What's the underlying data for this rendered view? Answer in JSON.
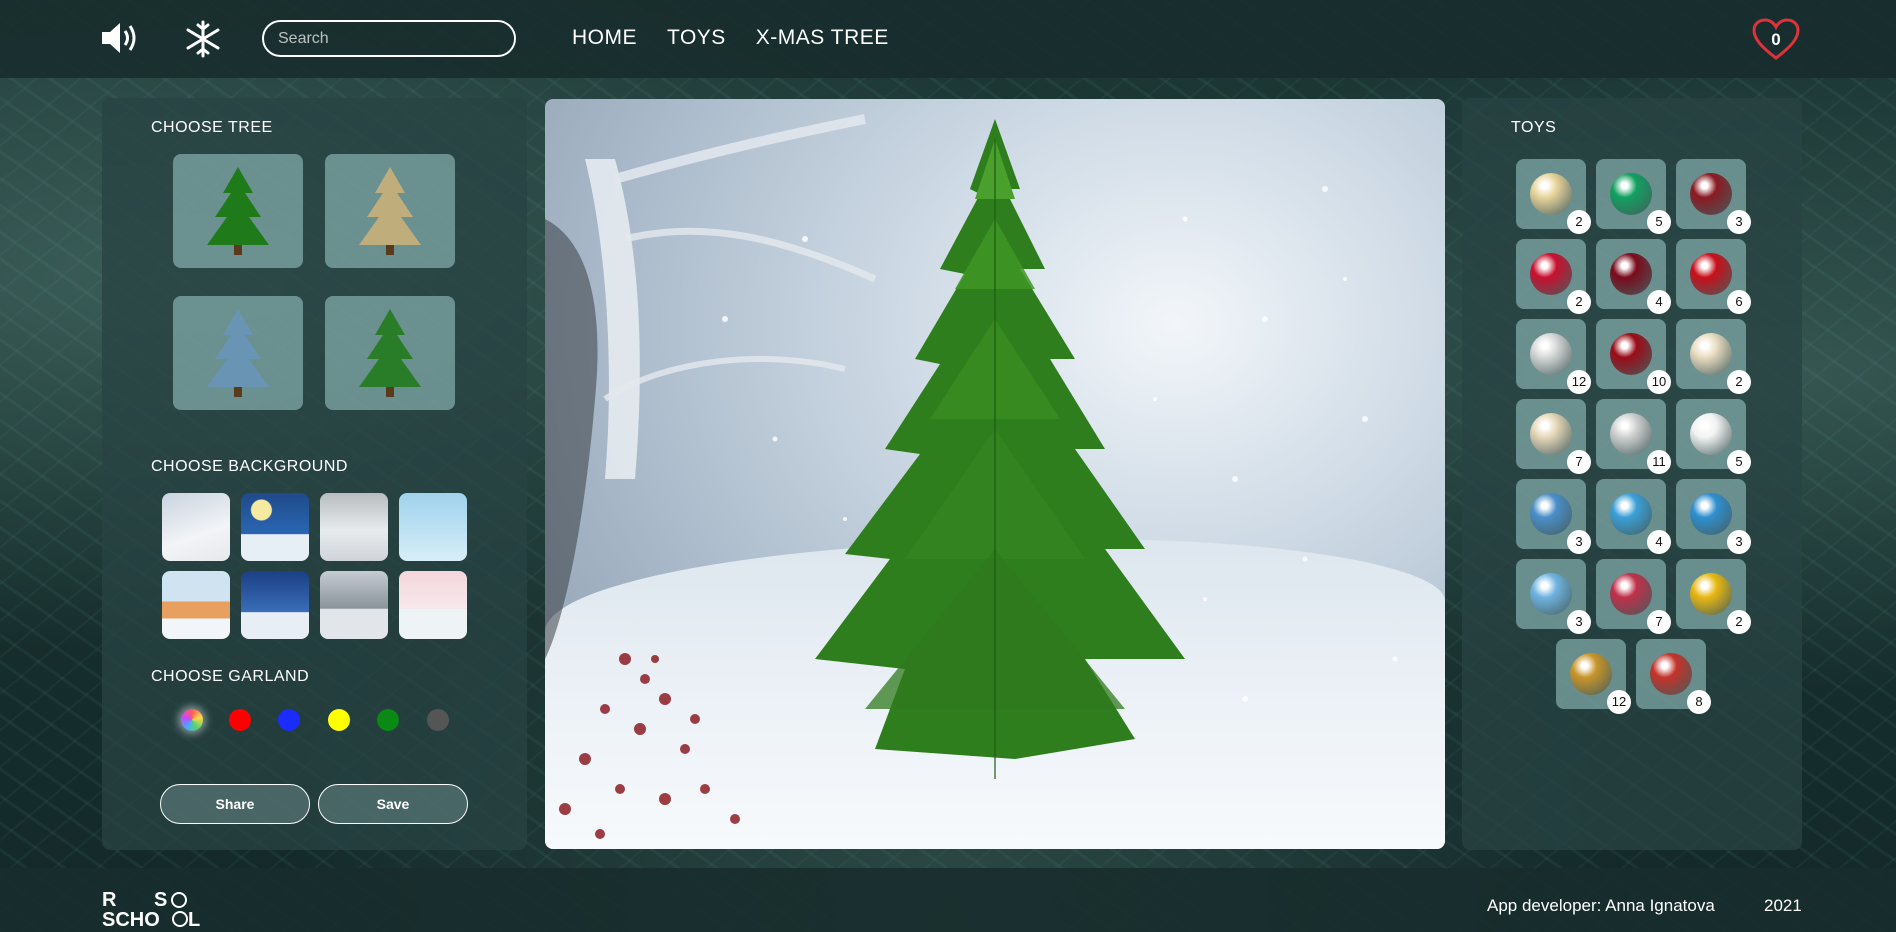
{
  "header": {
    "search_placeholder": "Search",
    "nav": [
      "HOME",
      "TOYS",
      "X-MAS TREE"
    ],
    "favorites_count": "0",
    "icons": {
      "sound": "speaker-icon",
      "snow": "snowflake-icon",
      "favorites": "heart-icon"
    }
  },
  "left": {
    "choose_tree": "CHOOSE TREE",
    "choose_background": "CHOOSE BACKGROUND",
    "choose_garland": "CHOOSE GARLAND",
    "garland_colors": [
      "multicolor",
      "#ff0000",
      "#1a2cff",
      "#ffff00",
      "#0a8a14",
      "#555555"
    ],
    "share": "Share",
    "save": "Save"
  },
  "toys": {
    "title": "TOYS",
    "items": [
      {
        "count": "2",
        "color": "#e8d49a"
      },
      {
        "count": "5",
        "color": "#12a060"
      },
      {
        "count": "3",
        "color": "#8a1a22"
      },
      {
        "count": "2",
        "color": "#c8102e"
      },
      {
        "count": "4",
        "color": "#7a0b1c"
      },
      {
        "count": "6",
        "color": "#c8101a"
      },
      {
        "count": "12",
        "color": "#d8d8d8"
      },
      {
        "count": "10",
        "color": "#9a0c18"
      },
      {
        "count": "2",
        "color": "#e9dcc0"
      },
      {
        "count": "7",
        "color": "#e6d7b8"
      },
      {
        "count": "11",
        "color": "#d0d0d0"
      },
      {
        "count": "5",
        "color": "#f2f2f2"
      },
      {
        "count": "3",
        "color": "#4a8ec9"
      },
      {
        "count": "4",
        "color": "#3aa0d8"
      },
      {
        "count": "3",
        "color": "#2f8fd0"
      },
      {
        "count": "3",
        "color": "#6fb3e0"
      },
      {
        "count": "7",
        "color": "#c0304a"
      },
      {
        "count": "2",
        "color": "#e8b812"
      },
      {
        "count": "12",
        "color": "#c8952a"
      },
      {
        "count": "8",
        "color": "#c4332a"
      }
    ]
  },
  "footer": {
    "logo": "RS SCHOOL",
    "developer": "App developer: Anna Ignatova",
    "year": "2021"
  }
}
